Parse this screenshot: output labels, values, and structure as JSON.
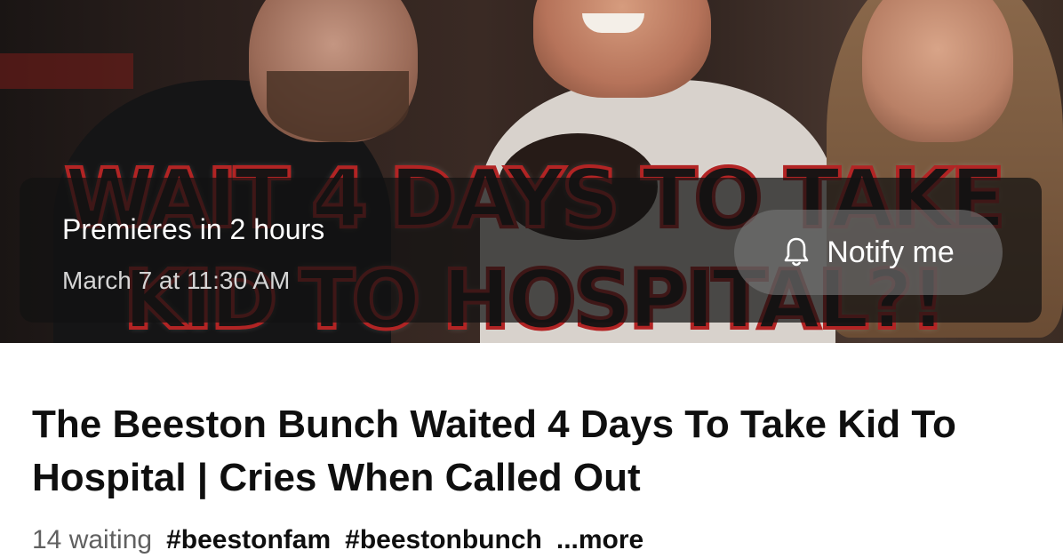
{
  "thumbnail": {
    "text_line1": "WAIT 4 DAYS TO TAKE",
    "text_line2": "KID TO HOSPITAL?!"
  },
  "premiere": {
    "status": "Premieres in 2 hours",
    "date": "March 7 at 11:30 AM",
    "notify_label": "Notify me",
    "notify_icon": "bell-icon"
  },
  "video": {
    "title": "The Beeston Bunch Waited 4 Days To Take Kid To Hospital | Cries When Called Out"
  },
  "meta": {
    "waiting": "14 waiting",
    "hashtags": [
      "#beestonfam",
      "#beestonbunch"
    ],
    "more_label": "...more"
  },
  "colors": {
    "overlay": "#121212",
    "title_text": "#0f0f0f",
    "secondary_text": "#606060",
    "thumb_text_stroke": "#b22424"
  }
}
